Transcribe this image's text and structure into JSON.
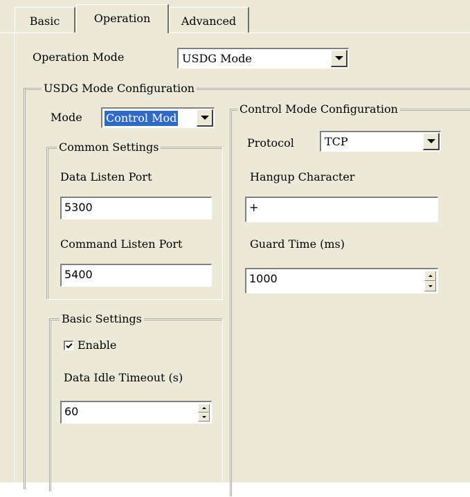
{
  "tabs": [
    {
      "label": "Basic",
      "selected": false
    },
    {
      "label": "Operation",
      "selected": true
    },
    {
      "label": "Advanced",
      "selected": false
    }
  ],
  "operation_mode": {
    "label": "Operation Mode",
    "value": "USDG Mode"
  },
  "usdg_config": {
    "title": "USDG Mode Configuration",
    "mode": {
      "label": "Mode",
      "value": "Control Mod"
    },
    "common_settings": {
      "title": "Common Settings",
      "data_listen_port": {
        "label": "Data Listen Port",
        "value": "5300"
      },
      "command_listen_port": {
        "label": "Command Listen Port",
        "value": "5400"
      }
    },
    "basic_settings": {
      "title": "Basic Settings",
      "enable": {
        "label": "Enable",
        "checked": true
      },
      "data_idle_timeout": {
        "label": "Data Idle Timeout (s)",
        "value": "60"
      }
    }
  },
  "control_config": {
    "title": "Control Mode Configuration",
    "protocol": {
      "label": "Protocol",
      "value": "TCP"
    },
    "hangup_character": {
      "label": "Hangup Character",
      "value": "+"
    },
    "guard_time": {
      "label": "Guard Time (ms)",
      "value": "1000"
    }
  },
  "colors": {
    "background": "#ece9d8",
    "selection": "#316ac5"
  }
}
